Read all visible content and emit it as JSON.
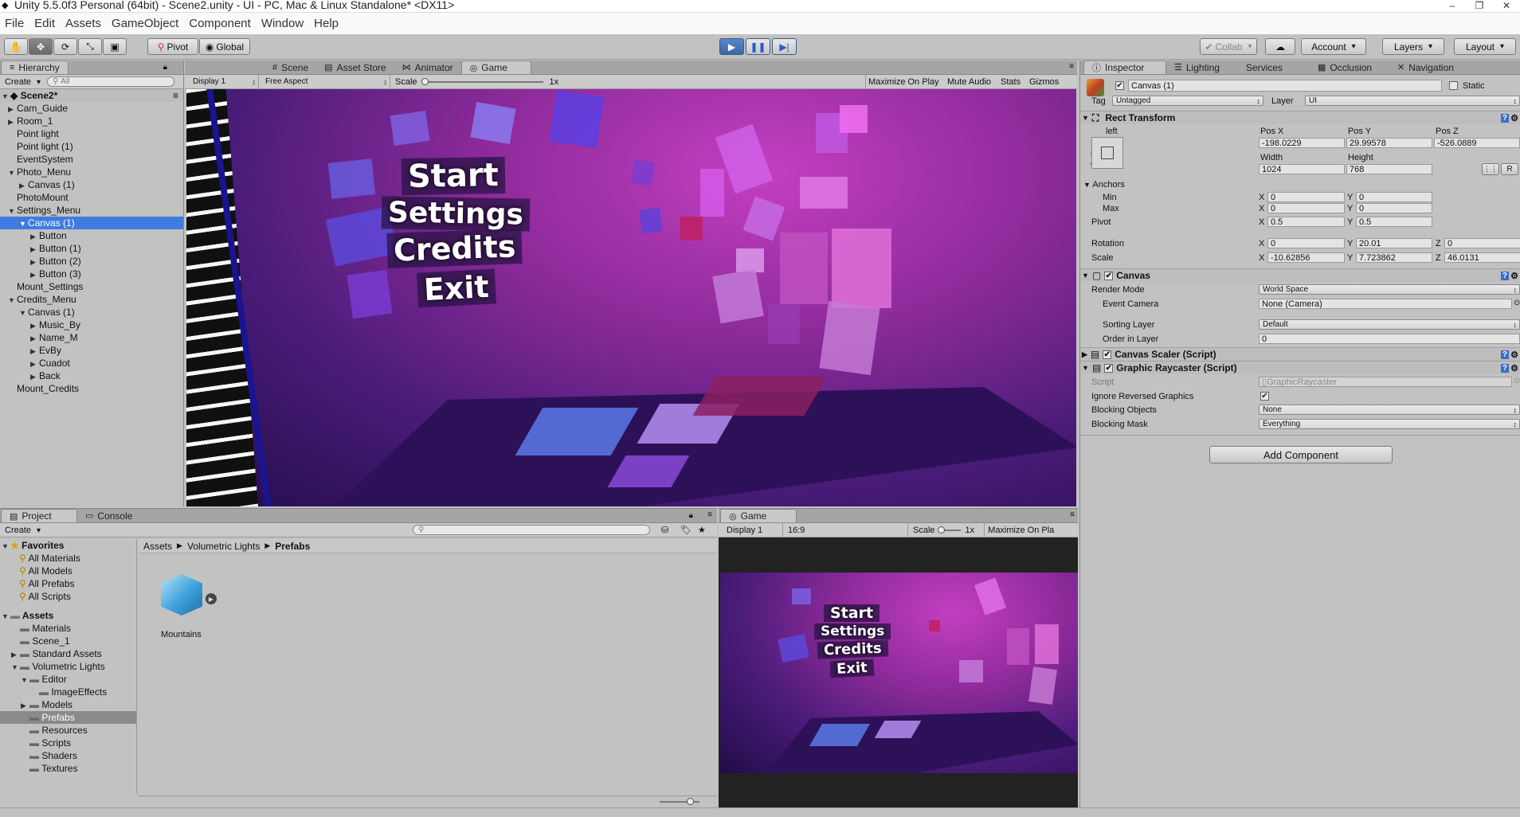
{
  "window": {
    "title": "Unity 5.5.0f3 Personal (64bit) - Scene2.unity - UI - PC, Mac & Linux Standalone* <DX11>",
    "minimize": "–",
    "maximize": "❐",
    "close": "✕"
  },
  "menubar": [
    "File",
    "Edit",
    "Assets",
    "GameObject",
    "Component",
    "Window",
    "Help"
  ],
  "toolbar": {
    "pivot": "Pivot",
    "global": "Global",
    "collab": "Collab",
    "account": "Account",
    "layers": "Layers",
    "layout": "Layout"
  },
  "hierarchy": {
    "tab": "Hierarchy",
    "create": "Create",
    "search_placeholder": "All",
    "scene": "Scene2*",
    "items": [
      {
        "label": "Cam_Guide",
        "indent": 1,
        "arrow": "▶"
      },
      {
        "label": "Room_1",
        "indent": 1,
        "arrow": "▶"
      },
      {
        "label": "Point light",
        "indent": 1,
        "arrow": ""
      },
      {
        "label": "Point light (1)",
        "indent": 1,
        "arrow": ""
      },
      {
        "label": "EventSystem",
        "indent": 1,
        "arrow": ""
      },
      {
        "label": "Photo_Menu",
        "indent": 1,
        "arrow": "▼"
      },
      {
        "label": "Canvas (1)",
        "indent": 2,
        "arrow": "▶"
      },
      {
        "label": "PhotoMount",
        "indent": 1,
        "arrow": ""
      },
      {
        "label": "Settings_Menu",
        "indent": 1,
        "arrow": "▼"
      },
      {
        "label": "Canvas (1)",
        "indent": 2,
        "arrow": "▼",
        "selected": true
      },
      {
        "label": "Button",
        "indent": 3,
        "arrow": "▶"
      },
      {
        "label": "Button (1)",
        "indent": 3,
        "arrow": "▶"
      },
      {
        "label": "Button (2)",
        "indent": 3,
        "arrow": "▶"
      },
      {
        "label": "Button (3)",
        "indent": 3,
        "arrow": "▶"
      },
      {
        "label": "Mount_Settings",
        "indent": 1,
        "arrow": ""
      },
      {
        "label": "Credits_Menu",
        "indent": 1,
        "arrow": "▼"
      },
      {
        "label": "Canvas (1)",
        "indent": 2,
        "arrow": "▼"
      },
      {
        "label": "Music_By",
        "indent": 3,
        "arrow": "▶"
      },
      {
        "label": "Name_M",
        "indent": 3,
        "arrow": "▶"
      },
      {
        "label": "EvBy",
        "indent": 3,
        "arrow": "▶"
      },
      {
        "label": "Cuadot",
        "indent": 3,
        "arrow": "▶"
      },
      {
        "label": "Back",
        "indent": 3,
        "arrow": "▶"
      },
      {
        "label": "Mount_Credits",
        "indent": 1,
        "arrow": ""
      }
    ]
  },
  "center": {
    "tabs": [
      "Scene",
      "Asset Store",
      "Animator",
      "Game"
    ],
    "display": "Display 1",
    "aspect": "Free Aspect",
    "scale_label": "Scale",
    "scale_value": "1x",
    "maximize": "Maximize On Play",
    "mute": "Mute Audio",
    "stats": "Stats",
    "gizmos": "Gizmos"
  },
  "game_menu": [
    "Start",
    "Settings",
    "Credits",
    "Exit"
  ],
  "inspector": {
    "tabs": [
      "Inspector",
      "Lighting",
      "Services",
      "Occlusion",
      "Navigation"
    ],
    "object_name": "Canvas (1)",
    "static": "Static",
    "tag_label": "Tag",
    "tag_value": "Untagged",
    "layer_label": "Layer",
    "layer_value": "UI",
    "rect_transform": {
      "title": "Rect Transform",
      "anchor_h": "left",
      "anchor_v": "bottom",
      "posx_label": "Pos X",
      "posy_label": "Pos Y",
      "posz_label": "Pos Z",
      "posx": "-198.0229",
      "posy": "29.99578",
      "posz": "-526.0889",
      "width_label": "Width",
      "height_label": "Height",
      "width": "1024",
      "height": "768",
      "anchors": "Anchors",
      "min": "Min",
      "max": "Max",
      "min_x": "0",
      "min_y": "0",
      "max_x": "0",
      "max_y": "0",
      "pivot": "Pivot",
      "pivot_x": "0.5",
      "pivot_y": "0.5",
      "rotation": "Rotation",
      "rot_x": "0",
      "rot_y": "20.01",
      "rot_z": "0",
      "scale": "Scale",
      "scale_x": "-10.62856",
      "scale_y": "7.723862",
      "scale_z": "46.0131",
      "raw": "R"
    },
    "canvas": {
      "title": "Canvas",
      "render_mode_label": "Render Mode",
      "render_mode": "World Space",
      "event_camera_label": "Event Camera",
      "event_camera": "None (Camera)",
      "sorting_layer_label": "Sorting Layer",
      "sorting_layer": "Default",
      "order_label": "Order in Layer",
      "order": "0"
    },
    "canvas_scaler": "Canvas Scaler (Script)",
    "raycaster": {
      "title": "Graphic Raycaster (Script)",
      "script_label": "Script",
      "script": "GraphicRaycaster",
      "ignore_label": "Ignore Reversed Graphics",
      "blocking_objects_label": "Blocking Objects",
      "blocking_objects": "None",
      "blocking_mask_label": "Blocking Mask",
      "blocking_mask": "Everything"
    },
    "add_component": "Add Component"
  },
  "project": {
    "tabs": [
      "Project",
      "Console"
    ],
    "create": "Create",
    "breadcrumb": [
      "Assets",
      "Volumetric Lights",
      "Prefabs"
    ],
    "favorites": "Favorites",
    "fav_items": [
      "All Materials",
      "All Models",
      "All Prefabs",
      "All Scripts"
    ],
    "assets": "Assets",
    "tree": [
      {
        "label": "Materials",
        "indent": 1,
        "arrow": ""
      },
      {
        "label": "Scene_1",
        "indent": 1,
        "arrow": ""
      },
      {
        "label": "Standard Assets",
        "indent": 1,
        "arrow": "▶"
      },
      {
        "label": "Volumetric Lights",
        "indent": 1,
        "arrow": "▼"
      },
      {
        "label": "Editor",
        "indent": 2,
        "arrow": "▼"
      },
      {
        "label": "ImageEffects",
        "indent": 3,
        "arrow": ""
      },
      {
        "label": "Models",
        "indent": 2,
        "arrow": "▶"
      },
      {
        "label": "Prefabs",
        "indent": 2,
        "arrow": "",
        "selected": true
      },
      {
        "label": "Resources",
        "indent": 2,
        "arrow": ""
      },
      {
        "label": "Scripts",
        "indent": 2,
        "arrow": ""
      },
      {
        "label": "Shaders",
        "indent": 2,
        "arrow": ""
      },
      {
        "label": "Textures",
        "indent": 2,
        "arrow": ""
      }
    ],
    "asset_name": "Mountains"
  },
  "game2": {
    "tab": "Game",
    "display": "Display 1",
    "aspect": "16:9",
    "scale_label": "Scale",
    "scale_value": "1x",
    "maximize": "Maximize On Pla"
  },
  "colors": {
    "selection": "#3e7ce2",
    "play_blue": "#3c66a8",
    "panel": "#c2c2c2"
  }
}
